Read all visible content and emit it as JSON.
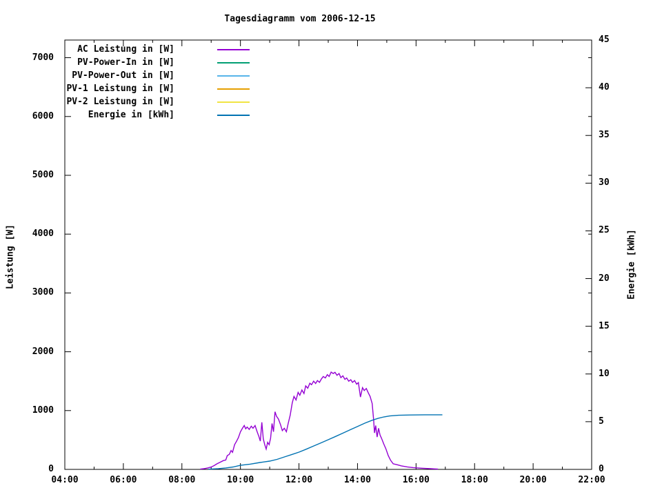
{
  "title": "Tagesdiagramm vom 2006-12-15",
  "colors": {
    "background": "#ffffff",
    "text": "#000000",
    "border": "#000000"
  },
  "chart_data": {
    "type": "line",
    "title": "Tagesdiagramm vom 2006-12-15",
    "grid": false,
    "legend_position": "top-left-inside",
    "x_axis": {
      "label": "",
      "range_hours": [
        4,
        22
      ],
      "minor_tick_step_hours": 1,
      "major_ticks": [
        {
          "h": 4,
          "label": "04:00"
        },
        {
          "h": 6,
          "label": "06:00"
        },
        {
          "h": 8,
          "label": "08:00"
        },
        {
          "h": 10,
          "label": "10:00"
        },
        {
          "h": 12,
          "label": "12:00"
        },
        {
          "h": 14,
          "label": "14:00"
        },
        {
          "h": 16,
          "label": "16:00"
        },
        {
          "h": 18,
          "label": "18:00"
        },
        {
          "h": 20,
          "label": "20:00"
        },
        {
          "h": 22,
          "label": "22:00"
        }
      ]
    },
    "y_left": {
      "label": "Leistung [W]",
      "range": [
        0,
        7300
      ],
      "ticks": [
        0,
        1000,
        2000,
        3000,
        4000,
        5000,
        6000,
        7000
      ]
    },
    "y_right": {
      "label": "Energie [kWh]",
      "range": [
        0,
        45
      ],
      "ticks": [
        0,
        5,
        10,
        15,
        20,
        25,
        30,
        35,
        40,
        45
      ]
    },
    "series": [
      {
        "name": "AC Leistung in [W]",
        "color": "#9400d3",
        "axis": "left",
        "points": [
          [
            8.63,
            5
          ],
          [
            8.75,
            12
          ],
          [
            8.88,
            25
          ],
          [
            9.0,
            40
          ],
          [
            9.1,
            65
          ],
          [
            9.2,
            95
          ],
          [
            9.3,
            120
          ],
          [
            9.42,
            150
          ],
          [
            9.5,
            160
          ],
          [
            9.55,
            235
          ],
          [
            9.62,
            255
          ],
          [
            9.68,
            320
          ],
          [
            9.73,
            290
          ],
          [
            9.8,
            420
          ],
          [
            9.87,
            480
          ],
          [
            9.93,
            540
          ],
          [
            10.0,
            640
          ],
          [
            10.07,
            700
          ],
          [
            10.13,
            745
          ],
          [
            10.18,
            690
          ],
          [
            10.23,
            720
          ],
          [
            10.3,
            680
          ],
          [
            10.37,
            735
          ],
          [
            10.43,
            700
          ],
          [
            10.5,
            745
          ],
          [
            10.57,
            640
          ],
          [
            10.63,
            560
          ],
          [
            10.68,
            480
          ],
          [
            10.73,
            800
          ],
          [
            10.78,
            520
          ],
          [
            10.83,
            420
          ],
          [
            10.88,
            345
          ],
          [
            10.93,
            460
          ],
          [
            10.98,
            420
          ],
          [
            11.03,
            530
          ],
          [
            11.08,
            780
          ],
          [
            11.13,
            640
          ],
          [
            11.18,
            980
          ],
          [
            11.23,
            905
          ],
          [
            11.3,
            855
          ],
          [
            11.37,
            760
          ],
          [
            11.43,
            660
          ],
          [
            11.5,
            700
          ],
          [
            11.57,
            640
          ],
          [
            11.63,
            780
          ],
          [
            11.7,
            920
          ],
          [
            11.77,
            1130
          ],
          [
            11.83,
            1240
          ],
          [
            11.9,
            1180
          ],
          [
            11.97,
            1310
          ],
          [
            12.03,
            1260
          ],
          [
            12.1,
            1350
          ],
          [
            12.17,
            1290
          ],
          [
            12.23,
            1420
          ],
          [
            12.3,
            1380
          ],
          [
            12.37,
            1465
          ],
          [
            12.43,
            1440
          ],
          [
            12.5,
            1500
          ],
          [
            12.57,
            1460
          ],
          [
            12.63,
            1510
          ],
          [
            12.7,
            1480
          ],
          [
            12.77,
            1540
          ],
          [
            12.83,
            1580
          ],
          [
            12.9,
            1555
          ],
          [
            12.97,
            1610
          ],
          [
            13.03,
            1580
          ],
          [
            13.1,
            1655
          ],
          [
            13.17,
            1630
          ],
          [
            13.23,
            1650
          ],
          [
            13.3,
            1600
          ],
          [
            13.37,
            1630
          ],
          [
            13.43,
            1560
          ],
          [
            13.5,
            1590
          ],
          [
            13.57,
            1530
          ],
          [
            13.63,
            1555
          ],
          [
            13.7,
            1500
          ],
          [
            13.77,
            1525
          ],
          [
            13.83,
            1480
          ],
          [
            13.9,
            1510
          ],
          [
            13.97,
            1450
          ],
          [
            14.03,
            1475
          ],
          [
            14.1,
            1230
          ],
          [
            14.17,
            1390
          ],
          [
            14.23,
            1340
          ],
          [
            14.3,
            1375
          ],
          [
            14.37,
            1300
          ],
          [
            14.43,
            1240
          ],
          [
            14.5,
            1120
          ],
          [
            14.55,
            845
          ],
          [
            14.58,
            620
          ],
          [
            14.62,
            745
          ],
          [
            14.67,
            550
          ],
          [
            14.72,
            700
          ],
          [
            14.77,
            585
          ],
          [
            14.82,
            530
          ],
          [
            14.9,
            430
          ],
          [
            14.97,
            350
          ],
          [
            15.05,
            235
          ],
          [
            15.13,
            155
          ],
          [
            15.22,
            95
          ],
          [
            15.35,
            80
          ],
          [
            15.5,
            60
          ],
          [
            15.7,
            42
          ],
          [
            15.9,
            30
          ],
          [
            16.2,
            20
          ],
          [
            16.5,
            12
          ],
          [
            16.75,
            5
          ]
        ]
      },
      {
        "name": "PV-Power-In in [W]",
        "color": "#009e73",
        "axis": "left",
        "points": []
      },
      {
        "name": "PV-Power-Out in [W]",
        "color": "#56b4e9",
        "axis": "left",
        "points": []
      },
      {
        "name": "PV-1 Leistung in [W]",
        "color": "#e69f00",
        "axis": "left",
        "points": []
      },
      {
        "name": "PV-2 Leistung in [W]",
        "color": "#f0e442",
        "axis": "left",
        "points": []
      },
      {
        "name": "Energie in [kWh]",
        "color": "#0072b2",
        "axis": "right",
        "points": [
          [
            8.9,
            0.02
          ],
          [
            9.25,
            0.08
          ],
          [
            9.5,
            0.15
          ],
          [
            9.75,
            0.25
          ],
          [
            10.0,
            0.43
          ],
          [
            10.33,
            0.55
          ],
          [
            10.67,
            0.72
          ],
          [
            11.0,
            0.87
          ],
          [
            11.25,
            1.05
          ],
          [
            11.5,
            1.3
          ],
          [
            11.75,
            1.55
          ],
          [
            12.0,
            1.81
          ],
          [
            12.25,
            2.12
          ],
          [
            12.5,
            2.45
          ],
          [
            12.75,
            2.78
          ],
          [
            13.0,
            3.11
          ],
          [
            13.25,
            3.45
          ],
          [
            13.5,
            3.8
          ],
          [
            13.75,
            4.15
          ],
          [
            14.0,
            4.49
          ],
          [
            14.25,
            4.85
          ],
          [
            14.5,
            5.15
          ],
          [
            14.7,
            5.35
          ],
          [
            14.9,
            5.5
          ],
          [
            15.1,
            5.6
          ],
          [
            15.4,
            5.67
          ],
          [
            15.8,
            5.7
          ],
          [
            16.3,
            5.72
          ],
          [
            16.9,
            5.72
          ]
        ]
      }
    ]
  }
}
